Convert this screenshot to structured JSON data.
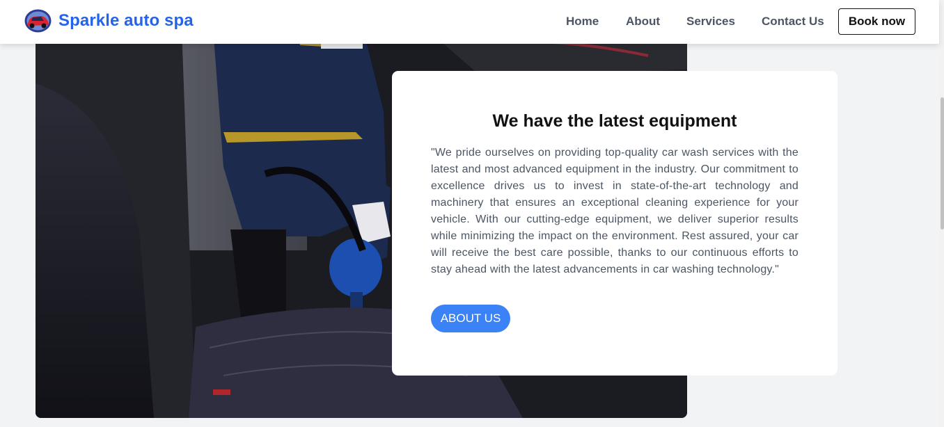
{
  "header": {
    "brand_name": "Sparkle auto spa",
    "nav": {
      "home": "Home",
      "about": "About",
      "services": "Services",
      "contact": "Contact Us"
    },
    "book_label": "Book now"
  },
  "feature": {
    "title": "We have the latest equipment",
    "body": "\"We pride ourselves on providing top-quality car wash services with the latest and most advanced equipment in the industry. Our commitment to excellence drives us to invest in state-of-the-art technology and machinery that ensures an exceptional cleaning experience for your vehicle. With our cutting-edge equipment, we deliver superior results while minimizing the impact on the environment. Rest assured, your car will receive the best care possible, thanks to our continuous efforts to stay ahead with the latest advancements in car washing technology.\"",
    "button_label": "ABOUT US"
  },
  "colors": {
    "brand": "#2563eb",
    "accent": "#3b82f6",
    "page_bg": "#f2f3f5"
  },
  "icons": {
    "brand_logo": "red-car-logo-icon"
  }
}
